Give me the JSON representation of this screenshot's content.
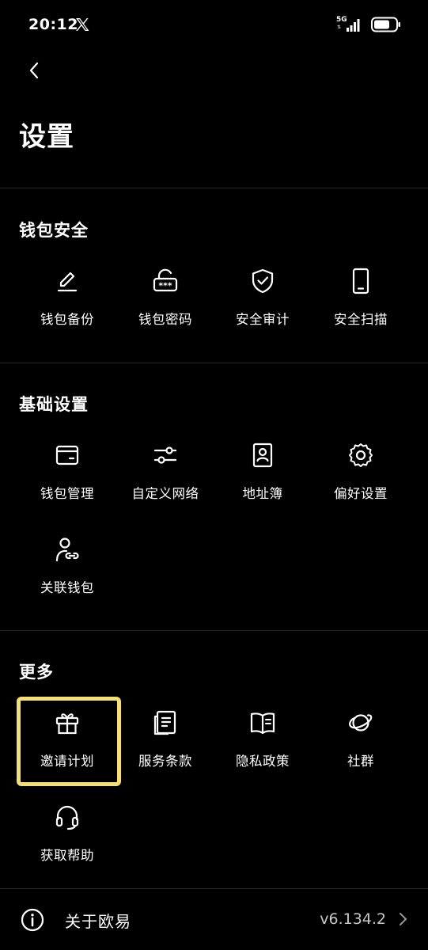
{
  "status_bar": {
    "time": "20:12",
    "network": "5G"
  },
  "header": {
    "title": "设置"
  },
  "sections": [
    {
      "title": "钱包安全",
      "items": [
        {
          "label": "钱包备份",
          "icon": "pencil-icon"
        },
        {
          "label": "钱包密码",
          "icon": "lock-password-icon"
        },
        {
          "label": "安全审计",
          "icon": "shield-check-icon"
        },
        {
          "label": "安全扫描",
          "icon": "phone-scan-icon"
        }
      ]
    },
    {
      "title": "基础设置",
      "items": [
        {
          "label": "钱包管理",
          "icon": "wallet-icon"
        },
        {
          "label": "自定义网络",
          "icon": "sliders-icon"
        },
        {
          "label": "地址簿",
          "icon": "address-book-icon"
        },
        {
          "label": "偏好设置",
          "icon": "gear-icon"
        },
        {
          "label": "关联钱包",
          "icon": "user-link-icon"
        }
      ]
    },
    {
      "title": "更多",
      "items": [
        {
          "label": "邀请计划",
          "icon": "gift-icon",
          "highlighted": true
        },
        {
          "label": "服务条款",
          "icon": "document-icon"
        },
        {
          "label": "隐私政策",
          "icon": "book-icon"
        },
        {
          "label": "社群",
          "icon": "planet-icon"
        },
        {
          "label": "获取帮助",
          "icon": "headset-icon"
        }
      ]
    }
  ],
  "about": {
    "label": "关于欧易",
    "version": "v6.134.2"
  },
  "colors": {
    "background": "#000000",
    "text": "#ffffff",
    "divider": "#262626",
    "highlight": "#f4df78"
  }
}
